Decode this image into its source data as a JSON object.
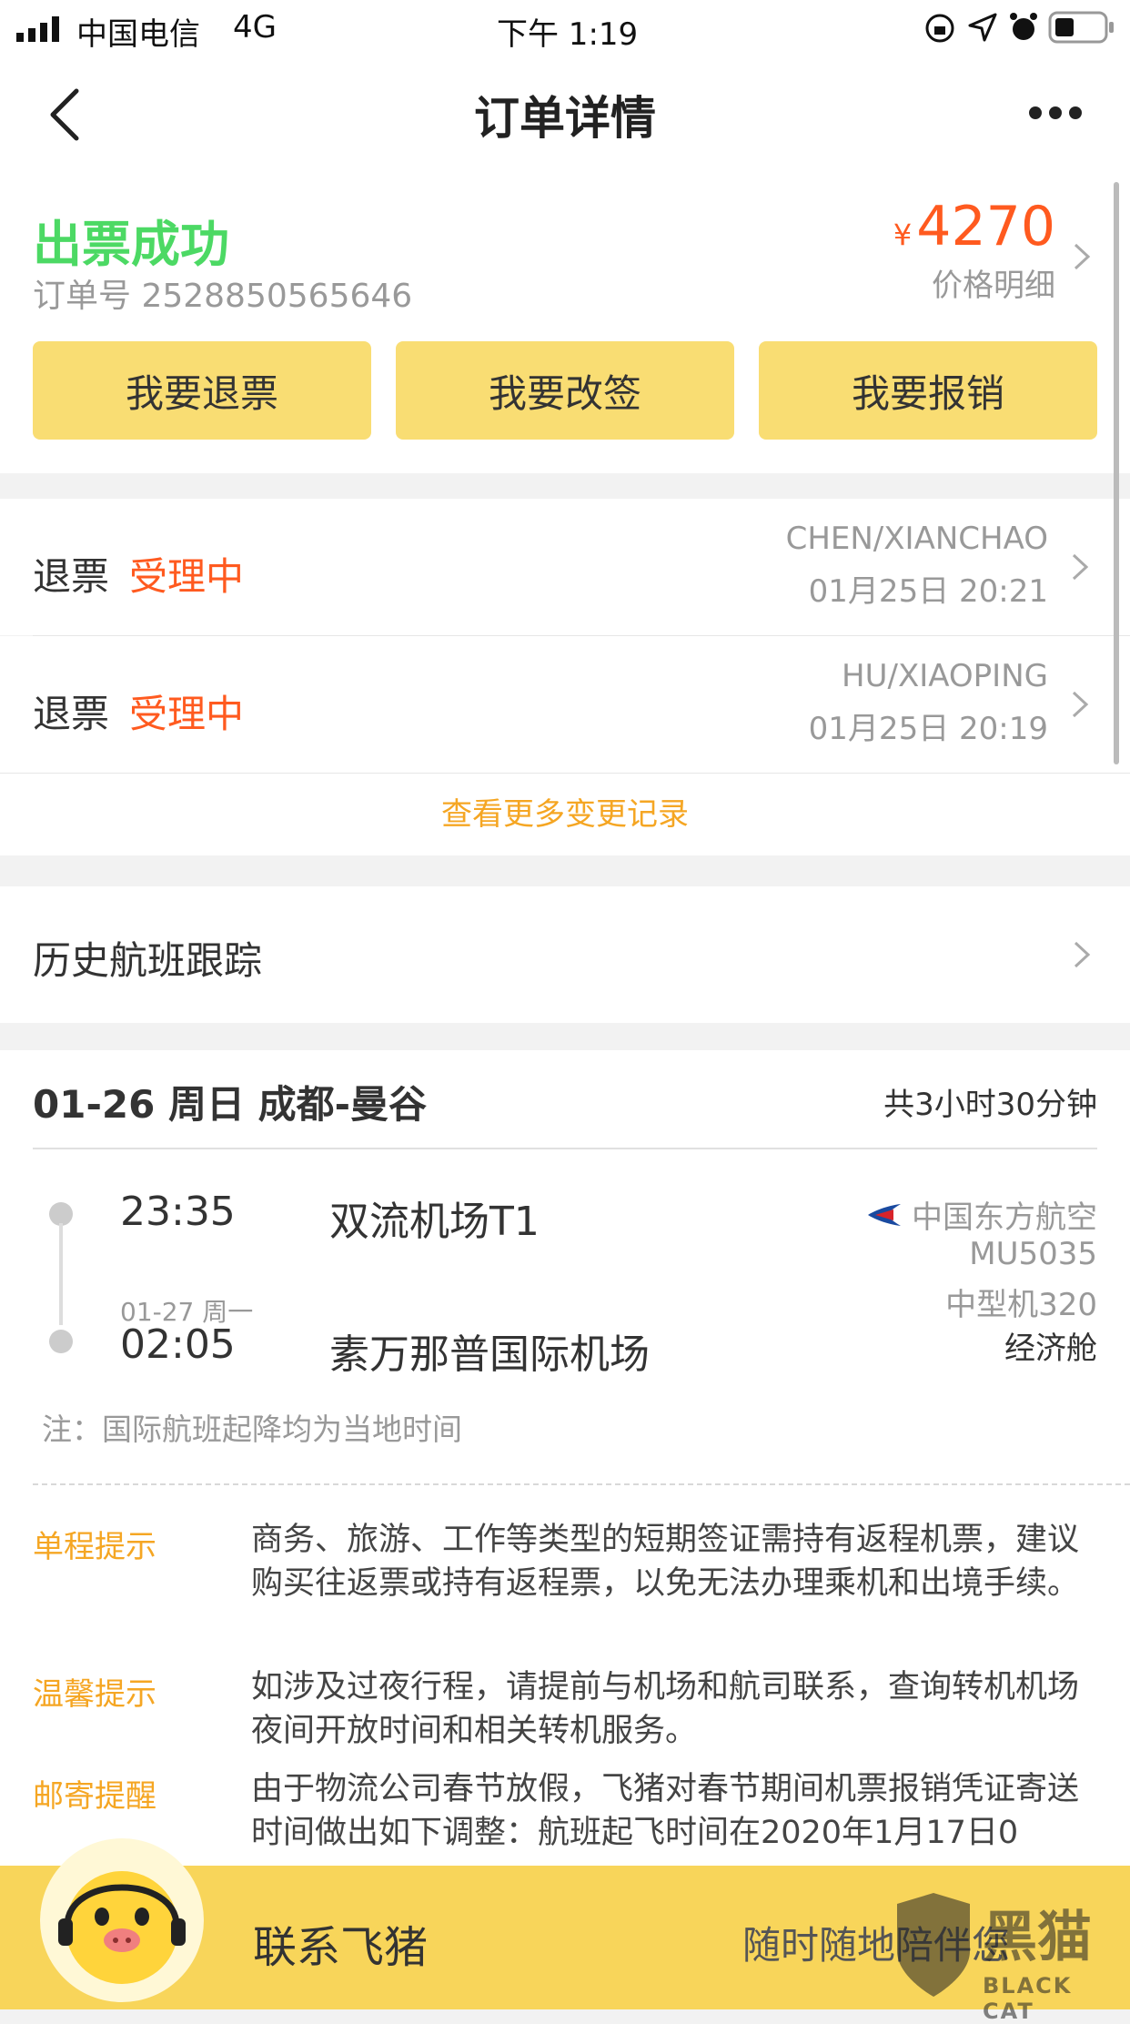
{
  "status_bar": {
    "carrier": "中国电信",
    "network": "4G",
    "time": "下午 1:19"
  },
  "nav": {
    "title": "订单详情"
  },
  "order": {
    "status": "出票成功",
    "order_no": "订单号 2528850565646",
    "currency": "¥",
    "price": "4270",
    "price_detail": "价格明细"
  },
  "actions": {
    "refund": "我要退票",
    "change": "我要改签",
    "reimburse": "我要报销"
  },
  "records": [
    {
      "type": "退票",
      "status": "受理中",
      "name": "CHEN/XIANCHAO",
      "time": "01月25日 20:21"
    },
    {
      "type": "退票",
      "status": "受理中",
      "name": "HU/XIAOPING",
      "time": "01月25日 20:19"
    }
  ],
  "more_records": "查看更多变更记录",
  "history_tracking": "历史航班跟踪",
  "flight": {
    "header": "01-26 周日 成都-曼谷",
    "duration": "共3小时30分钟",
    "dep_time": "23:35",
    "dep_airport": "双流机场T1",
    "arr_date": "01-27 周一",
    "arr_time": "02:05",
    "arr_airport": "素万那普国际机场",
    "airline": "中国东方航空",
    "flight_no": "MU5035",
    "aircraft": "中型机320",
    "cabin": "经济舱",
    "note": "注：国际航班起降均为当地时间"
  },
  "tips": [
    {
      "label": "单程提示",
      "text": "商务、旅游、工作等类型的短期签证需持有返程机票，建议购买往返票或持有返程票，以免无法办理乘机和出境手续。"
    },
    {
      "label": "温馨提示",
      "text": "如涉及过夜行程，请提前与机场和航司联系，查询转机机场夜间开放时间和相关转机服务。"
    },
    {
      "label": "邮寄提醒",
      "text": "由于物流公司春节放假，飞猪对春节期间机票报销凭证寄送时间做出如下调整：航班起飞时间在2020年1月17日0"
    }
  ],
  "contact_bar": {
    "label": "联系飞猪",
    "slogan": "随时随地陪伴您",
    "watermark_cn": "黑猫",
    "watermark_en": "BLACK CAT"
  },
  "colors": {
    "accent_yellow": "#f9dd73",
    "success_green": "#4cd964",
    "price_orange": "#ff5a1f",
    "link_orange": "#f5a623"
  }
}
